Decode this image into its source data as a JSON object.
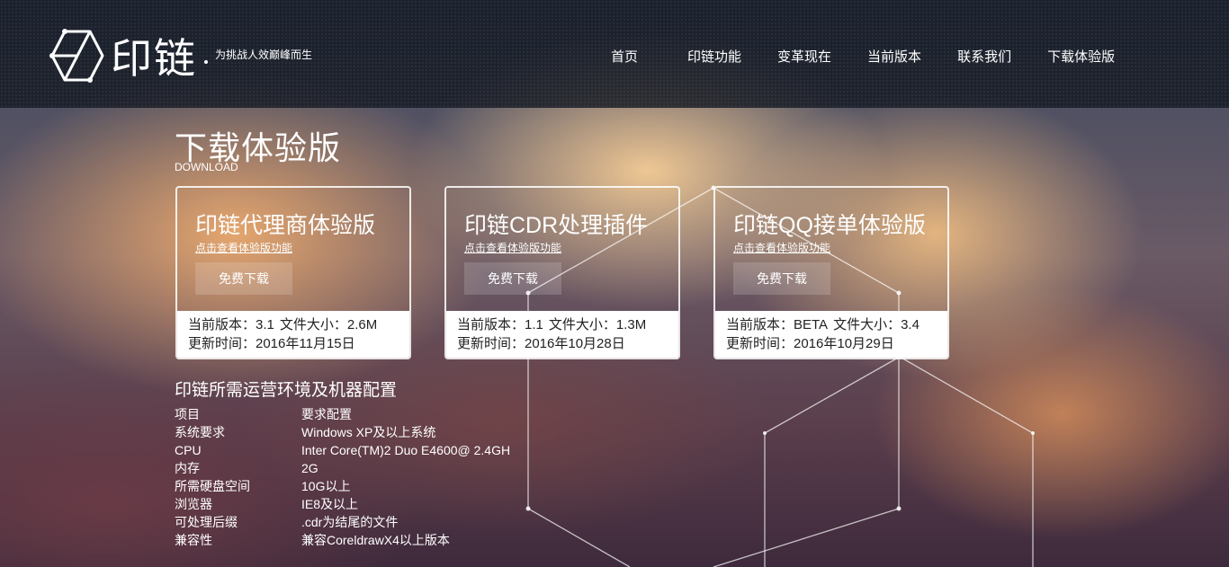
{
  "brand": {
    "name": "印链",
    "slogan": "为挑战人效巅峰而生"
  },
  "nav": [
    {
      "label": "首页"
    },
    {
      "label": "印链功能"
    },
    {
      "label": "变革现在"
    },
    {
      "label": "当前版本"
    },
    {
      "label": "联系我们"
    },
    {
      "label": "下载体验版"
    }
  ],
  "section": {
    "title": "下载体验版",
    "subtitle": "DOWNLOAD"
  },
  "cards": [
    {
      "title": "印链代理商体验版",
      "link": "点击查看体验版功能",
      "button": "免费下载",
      "version": "当前版本：3.1",
      "size": "文件大小：2.6M",
      "updated": "更新时间：2016年11月15日"
    },
    {
      "title": "印链CDR处理插件",
      "link": "点击查看体验版功能",
      "button": "免费下载",
      "version": "当前版本：1.1",
      "size": "文件大小：1.3M",
      "updated": "更新时间：2016年10月28日"
    },
    {
      "title": "印链QQ接单体验版",
      "link": "点击查看体验版功能",
      "button": "免费下载",
      "version": "当前版本：BETA",
      "size": "文件大小：3.4",
      "updated": "更新时间：2016年10月29日"
    }
  ],
  "requirements": {
    "title": "印链所需运营环境及机器配置",
    "rows": [
      {
        "key": "项目",
        "value": "要求配置"
      },
      {
        "key": "系统要求",
        "value": "Windows XP及以上系统"
      },
      {
        "key": "CPU",
        "value": "Inter Core(TM)2 Duo E4600@ 2.4GH"
      },
      {
        "key": "内存",
        "value": "2G"
      },
      {
        "key": "所需硬盘空间",
        "value": "10G以上"
      },
      {
        "key": "浏览器",
        "value": "IE8及以上"
      },
      {
        "key": "可处理后缀",
        "value": ".cdr为结尾的文件"
      },
      {
        "key": "兼容性",
        "value": "兼容CoreldrawX4以上版本"
      }
    ]
  }
}
